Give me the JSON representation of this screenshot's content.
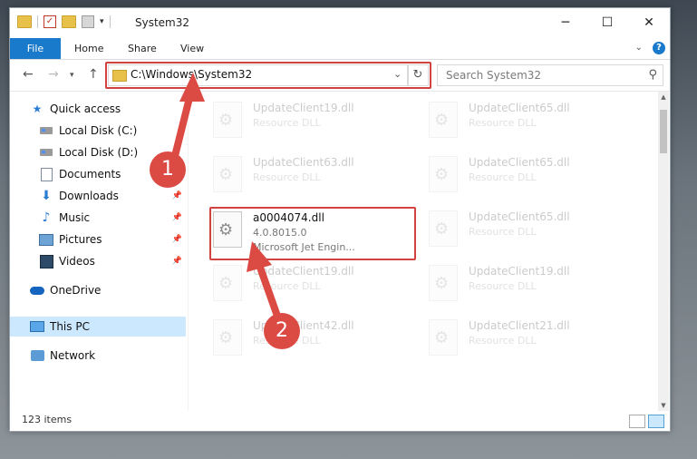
{
  "window": {
    "title": "System32",
    "minimize_glyph": "─",
    "maximize_glyph": "☐",
    "close_glyph": "✕"
  },
  "ribbon": {
    "tabs": [
      "File",
      "Home",
      "Share",
      "View"
    ],
    "help_label": "?"
  },
  "address": {
    "path": "C:\\Windows\\System32",
    "search_placeholder": "Search System32"
  },
  "sidebar": {
    "items": [
      {
        "label": "Quick access",
        "icon": "star-icon",
        "pinned": false
      },
      {
        "label": "Local Disk (C:)",
        "icon": "drive-icon",
        "pinned": true
      },
      {
        "label": "Local Disk (D:)",
        "icon": "drive-icon",
        "pinned": true
      },
      {
        "label": "Documents",
        "icon": "documents-icon",
        "pinned": true
      },
      {
        "label": "Downloads",
        "icon": "download-icon",
        "pinned": true
      },
      {
        "label": "Music",
        "icon": "music-icon",
        "pinned": true
      },
      {
        "label": "Pictures",
        "icon": "pictures-icon",
        "pinned": true
      },
      {
        "label": "Videos",
        "icon": "videos-icon",
        "pinned": true
      },
      {
        "label": "OneDrive",
        "icon": "onedrive-icon",
        "pinned": false
      },
      {
        "label": "This PC",
        "icon": "this-pc-icon",
        "pinned": false,
        "selected": true
      },
      {
        "label": "Network",
        "icon": "network-icon",
        "pinned": false
      }
    ]
  },
  "files": {
    "left_column": [
      {
        "name": "UpdateClient19.dll",
        "type": "Resource DLL"
      },
      {
        "name": "UpdateClient63.dll",
        "type": "Resource DLL"
      },
      {
        "name": "a0004074.dll",
        "version": "4.0.8015.0",
        "description": "Microsoft Jet Engin...",
        "highlighted": true
      },
      {
        "name": "UpdateClient19.dll",
        "type": "Resource DLL"
      },
      {
        "name": "UpdateClient42.dll",
        "type": "Resource DLL"
      }
    ],
    "right_column": [
      {
        "name": "UpdateClient65.dll",
        "type": "Resource DLL"
      },
      {
        "name": "UpdateClient65.dll",
        "type": "Resource DLL"
      },
      {
        "name": "UpdateClient65.dll",
        "type": "Resource DLL"
      },
      {
        "name": "UpdateClient19.dll",
        "type": "Resource DLL"
      },
      {
        "name": "UpdateClient21.dll",
        "type": "Resource DLL"
      }
    ]
  },
  "annotations": {
    "step1": "1",
    "step2": "2",
    "color": "#dc4a44"
  },
  "status": {
    "item_count": "123 items"
  }
}
